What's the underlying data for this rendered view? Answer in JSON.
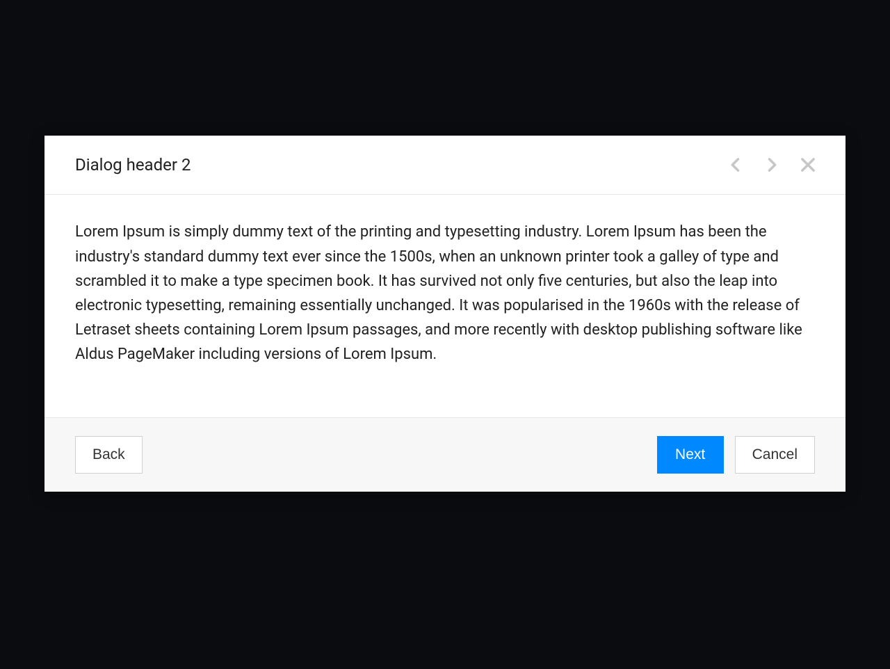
{
  "dialog": {
    "title": "Dialog header 2",
    "body": "Lorem Ipsum is simply dummy text of the printing and typesetting industry. Lorem Ipsum has been the industry's standard dummy text ever since the 1500s, when an unknown printer took a galley of type and scrambled it to make a type specimen book. It has survived not only five centuries, but also the leap into electronic typesetting, remaining essentially unchanged. It was popularised in the 1960s with the release of Letraset sheets containing Lorem Ipsum passages, and more recently with desktop publishing software like Aldus PageMaker including versions of Lorem Ipsum.",
    "footer": {
      "back_label": "Back",
      "next_label": "Next",
      "cancel_label": "Cancel"
    }
  }
}
